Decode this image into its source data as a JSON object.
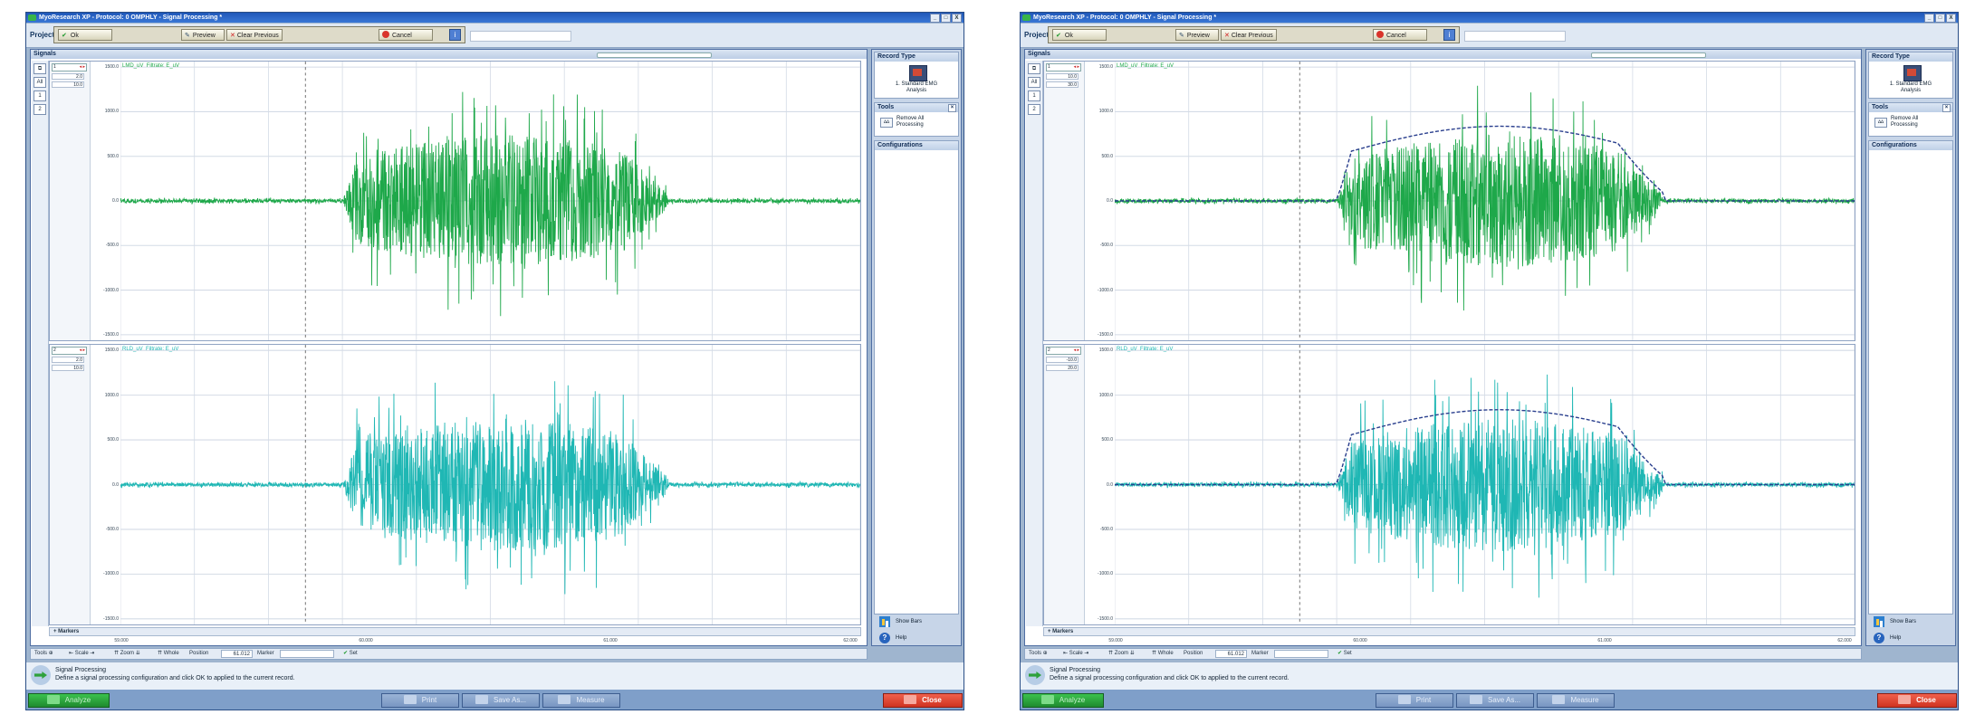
{
  "window_title": "MyoResearch XP - Protocol: 0 OMPHLY - Signal Processing *",
  "title_buttons": [
    "_",
    "□",
    "X"
  ],
  "project_label": "Project",
  "processing": {
    "ok_label": "Ok",
    "preview_label": "Preview",
    "clear_label": "Clear Previous",
    "cancel_label": "Cancel"
  },
  "signals_title": "Signals",
  "left_tools": [
    "⧉",
    "All",
    "1",
    "2"
  ],
  "y_ticks": [
    "1500.0",
    "1000.0",
    "500.0",
    "0.0",
    "-500.0",
    "-1000.0",
    "-1500.0"
  ],
  "x_ticks": [
    "59.000",
    "60.000",
    "61.000",
    "62.000"
  ],
  "markers_label": "Markers",
  "record_type": {
    "title": "Record Type",
    "option_line1": "1. Standard EMG",
    "option_line2": "Analysis"
  },
  "tools_section": {
    "title": "Tools",
    "button_line1": "Remove All",
    "button_line2": "Processing"
  },
  "configurations_title": "Configurations",
  "show_bars_label": "Show Bars",
  "help_label": "Help",
  "toolbar": {
    "tools_label": "Tools",
    "scale_label": "Scale",
    "zoom_label": "Zoom",
    "whole_label": "Whole",
    "position_label": "Position",
    "position_value": "61.012",
    "marker_label": "Marker",
    "set_label": "Set"
  },
  "status": {
    "title": "Signal Processing",
    "description": "Define a signal processing configuration and click OK to applied to the current record."
  },
  "bottom_buttons": {
    "analyze": "Analyze",
    "print": "Print",
    "save_as": "Save As...",
    "measure": "Measure",
    "close": "Close"
  },
  "colors": {
    "channel1": "#1ea84a",
    "channel2": "#1fb7b4",
    "envelope1": "#2a3f8e",
    "envelope2": "#2a3f8e",
    "close_button": "#dc3b28",
    "analyze_button": "#2fae3f"
  },
  "views": [
    {
      "channels": [
        {
          "number": "1",
          "label": "LMD_uV",
          "filter_label": "Filtrate: E_uV",
          "scale_values": [
            "2.0",
            "10.0"
          ],
          "color": "#1ea84a",
          "envelope": false
        },
        {
          "number": "2",
          "label": "RLD_uV",
          "filter_label": "Filtrate: E_uV",
          "scale_values": [
            "2.0",
            "10.0"
          ],
          "color": "#1fb7b4",
          "envelope": false
        }
      ]
    },
    {
      "channels": [
        {
          "number": "1",
          "label": "LMD_uV",
          "filter_label": "Filtrate: E_uV",
          "scale_values": [
            "10.0",
            "30.0"
          ],
          "color": "#1ea84a",
          "envelope": true
        },
        {
          "number": "2",
          "label": "RLD_uV",
          "filter_label": "Filtrate: E_uV",
          "scale_values": [
            "-10.0",
            "20.0"
          ],
          "color": "#1fb7b4",
          "envelope": true
        }
      ]
    }
  ]
}
